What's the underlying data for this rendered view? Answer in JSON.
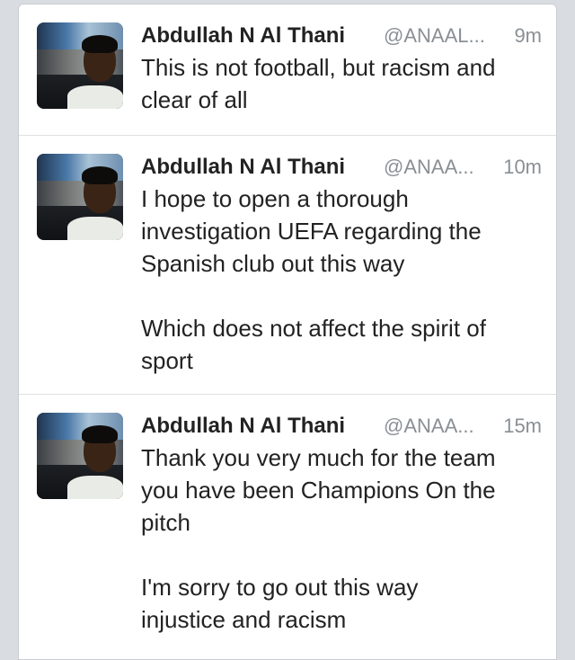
{
  "tweets": [
    {
      "author": "Abdullah N Al Thani",
      "handle": "@ANAAL...",
      "time": "9m",
      "text": "This is not football, but racism and\nclear of all"
    },
    {
      "author": "Abdullah N Al Thani",
      "handle": "@ANAA...",
      "time": "10m",
      "text": "I hope to open a thorough\ninvestigation UEFA regarding the\nSpanish club out this way\n\nWhich does not affect the spirit of\nsport"
    },
    {
      "author": "Abdullah N Al Thani",
      "handle": "@ANAA...",
      "time": "15m",
      "text": "Thank you very much for the team\nyou have been Champions On the\npitch\n\nI'm sorry to go out this way\ninjustice and racism"
    }
  ]
}
